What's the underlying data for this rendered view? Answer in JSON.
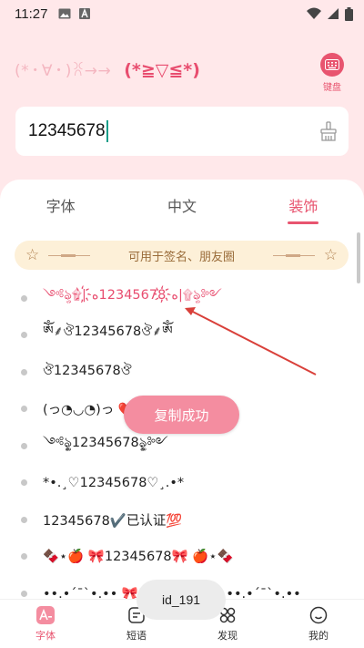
{
  "status_bar": {
    "time": "11:27"
  },
  "header": {
    "kaomoji_left": "(*・∀・)ꐦ→→",
    "kaomoji_right": "(*≧▽≦*)",
    "keyboard_label": "键盘"
  },
  "input": {
    "value": "12345678"
  },
  "tabs": [
    {
      "label": "字体",
      "active": false
    },
    {
      "label": "中文",
      "active": false
    },
    {
      "label": "装饰",
      "active": true
    }
  ],
  "banner": {
    "text": "可用于签名、朋友圈"
  },
  "list": [
    "༺ৡ۩|ه҉12345678ه҉|۩ৡ༻",
    "ༀ⸙ঔ12345678ঔ⸙ༀ",
    "ঔ12345678ঔ",
    "(っ◔◡◔)っ ❤️",
    "༺ৡৢ12345678ৡৢ༻",
    "*•.¸♡12345678♡¸.•*",
    "12345678✔️已认证💯",
    "🍫⋆🍎 🎀12345678🎀 🍎⋆🍫",
    "••.•´¯`•.•• 🎀12345678🎀 ••.•´¯`•.••"
  ],
  "toast": {
    "text": "复制成功"
  },
  "id_toast": {
    "text": "id_191"
  },
  "bottom_nav": [
    {
      "label": "字体",
      "icon": "font-icon",
      "active": true
    },
    {
      "label": "短语",
      "icon": "phrase-icon",
      "active": false
    },
    {
      "label": "发现",
      "icon": "discover-icon",
      "active": false
    },
    {
      "label": "我的",
      "icon": "profile-icon",
      "active": false
    }
  ],
  "colors": {
    "accent": "#e8546f",
    "background": "#ffe8ea",
    "toast": "#f48da0",
    "banner_bg": "#fdf0d8"
  }
}
